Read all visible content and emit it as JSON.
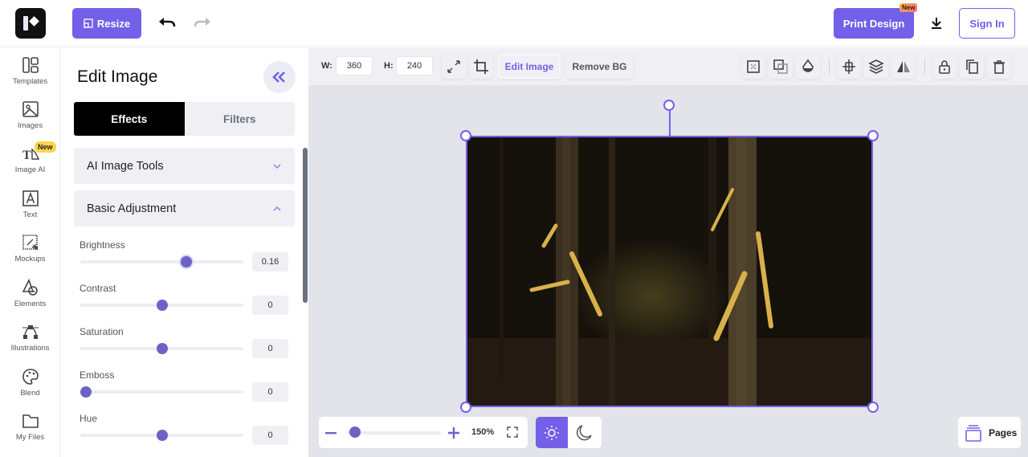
{
  "header": {
    "logo_label": "Logo",
    "resize_label": "Resize",
    "undo_icon": "undo-icon",
    "redo_icon": "redo-icon",
    "print_label": "Print Design",
    "print_badge": "New",
    "download_icon": "download-icon",
    "signin_label": "Sign In"
  },
  "sidebar": {
    "items": [
      {
        "label": "Templates",
        "icon": "templates-icon"
      },
      {
        "label": "Images",
        "icon": "image-icon"
      },
      {
        "label": "Image AI",
        "icon": "image-ai-icon",
        "badge": "New"
      },
      {
        "label": "Text",
        "icon": "text-icon"
      },
      {
        "label": "Mockups",
        "icon": "mockups-icon"
      },
      {
        "label": "Elements",
        "icon": "elements-icon"
      },
      {
        "label": "Illustrations",
        "icon": "illustrations-icon"
      },
      {
        "label": "Blend",
        "icon": "palette-icon"
      },
      {
        "label": "My Files",
        "icon": "folder-icon"
      }
    ]
  },
  "panel": {
    "title": "Edit Image",
    "tabs": [
      {
        "label": "Effects",
        "active": true
      },
      {
        "label": "Filters",
        "active": false
      }
    ],
    "accordions": [
      {
        "label": "AI Image Tools",
        "expanded": false
      },
      {
        "label": "Basic Adjustment",
        "expanded": true
      }
    ],
    "sliders": [
      {
        "label": "Brightness",
        "value": "0.16",
        "position_fraction": 0.65
      },
      {
        "label": "Contrast",
        "value": "0",
        "position_fraction": 0.5
      },
      {
        "label": "Saturation",
        "value": "0",
        "position_fraction": 0.5
      },
      {
        "label": "Emboss",
        "value": "0",
        "position_fraction": 0.0
      },
      {
        "label": "Hue",
        "value": "0",
        "position_fraction": 0.5
      }
    ]
  },
  "toolbar": {
    "width_label": "W:",
    "width_value": "360",
    "height_label": "H:",
    "height_value": "240",
    "edit_image_label": "Edit Image",
    "remove_bg_label": "Remove BG"
  },
  "canvas": {
    "image_alt": "Dark forest at night with glowing hands reaching from tree trunks"
  },
  "zoom": {
    "value": "150%",
    "position_fraction": 0.06
  },
  "theme": {
    "active": "light"
  },
  "pages": {
    "label": "Pages"
  },
  "colors": {
    "accent": "#7360e8",
    "slider": "#6c63c5",
    "panel_bg": "#f0f0f4",
    "canvas_bg": "#e3e4ea"
  }
}
